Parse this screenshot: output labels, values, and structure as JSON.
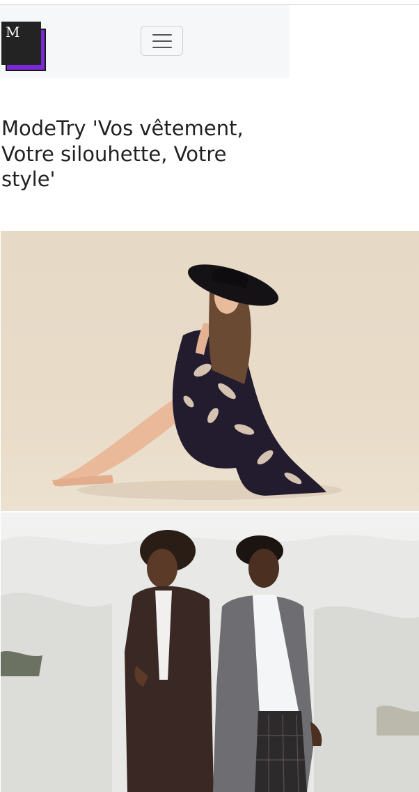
{
  "navbar": {
    "logo_letter": "M",
    "logo_colors": {
      "front": "#232323",
      "shadow": "#7a2bd6"
    },
    "toggler_icon": "hamburger-menu-icon"
  },
  "hero": {
    "headline": "ModeTry 'Vos vêtement, Votre silouhette, Votre style'"
  },
  "gallery": {
    "images": [
      {
        "name": "woman-in-hat-photo"
      },
      {
        "name": "two-men-coats-photo"
      }
    ]
  }
}
